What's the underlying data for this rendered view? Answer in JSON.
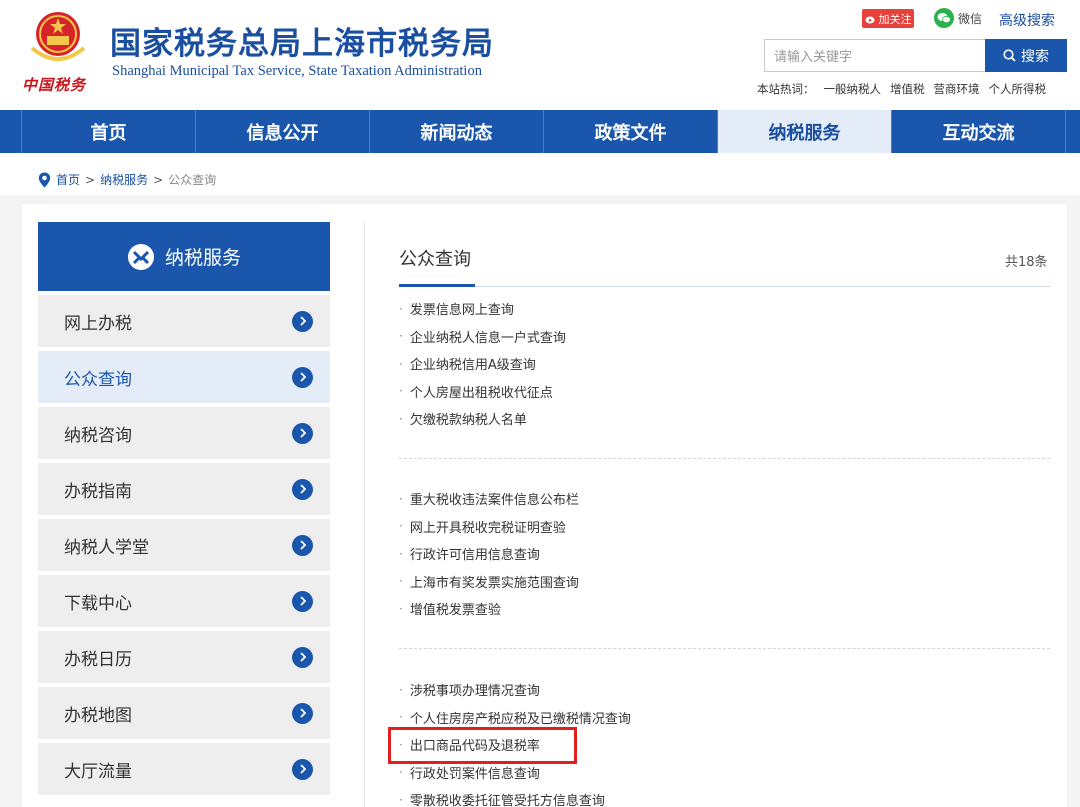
{
  "header": {
    "brand_cn": "中国税务",
    "title_cn": "国家税务总局上海市税务局",
    "title_en": "Shanghai Municipal Tax Service, State Taxation Administration",
    "follow_label": "加关注",
    "wechat_label": "微信",
    "advanced_search": "高级搜索",
    "search_placeholder": "请输入关键字",
    "search_button": "搜索",
    "hot_label": "本站热词：",
    "hot_words": [
      "一般纳税人",
      "增值税",
      "营商环境",
      "个人所得税"
    ]
  },
  "nav": [
    "首页",
    "信息公开",
    "新闻动态",
    "政策文件",
    "纳税服务",
    "互动交流"
  ],
  "nav_active": "纳税服务",
  "breadcrumb": {
    "home": "首页",
    "sep1": ">",
    "section": "纳税服务",
    "sep2": ">",
    "current": "公众查询"
  },
  "sidebar": {
    "title": "纳税服务",
    "items": [
      "网上办税",
      "公众查询",
      "纳税咨询",
      "办税指南",
      "纳税人学堂",
      "下载中心",
      "办税日历",
      "办税地图",
      "大厅流量"
    ],
    "active": "公众查询"
  },
  "main": {
    "title": "公众查询",
    "count": "共18条",
    "groups": [
      [
        "发票信息网上查询",
        "企业纳税人信息一户式查询",
        "企业纳税信用A级查询",
        "个人房屋出租税收代征点",
        "欠缴税款纳税人名单"
      ],
      [
        "重大税收违法案件信息公布栏",
        "网上开具税收完税证明查验",
        "行政许可信用信息查询",
        "上海市有奖发票实施范围查询",
        "增值税发票查验"
      ],
      [
        "涉税事项办理情况查询",
        "个人住房房产税应税及已缴税情况查询",
        "出口商品代码及退税率",
        "行政处罚案件信息查询",
        "零散税收委托征管受托方信息查询"
      ]
    ],
    "highlighted": "出口商品代码及退税率"
  },
  "colors": {
    "brand_blue": "#1a56ab",
    "highlight_red": "#e0201f"
  }
}
